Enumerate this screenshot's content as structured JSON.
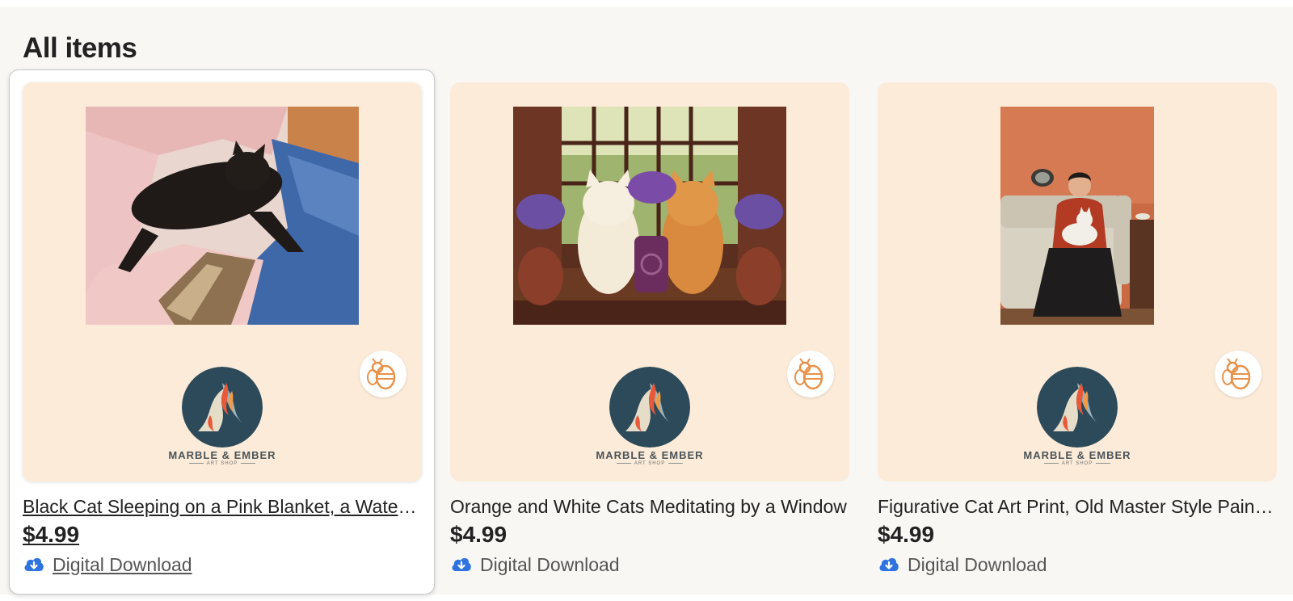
{
  "section": {
    "heading": "All items"
  },
  "shop": {
    "logo_name": "MARBLE & EMBER",
    "logo_tagline": "ART SHOP"
  },
  "colors": {
    "thumbnail_background": "#fcebd8",
    "bee_orange": "#e8924a",
    "download_icon": "#2f73e0"
  },
  "listings": [
    {
      "title": "Black Cat Sleeping on a Pink Blanket, a Watercolor Art Print",
      "price": "$4.99",
      "delivery": "Digital Download",
      "artwork": "black-cat-sleeping-on-pink-blanket"
    },
    {
      "title": "Orange and White Cats Meditating by a Window",
      "price": "$4.99",
      "delivery": "Digital Download",
      "artwork": "two-cats-with-tulips-and-mug"
    },
    {
      "title": "Figurative Cat Art Print, Old Master Style Painting",
      "price": "$4.99",
      "delivery": "Digital Download",
      "artwork": "woman-on-sofa-holding-white-cat"
    }
  ]
}
